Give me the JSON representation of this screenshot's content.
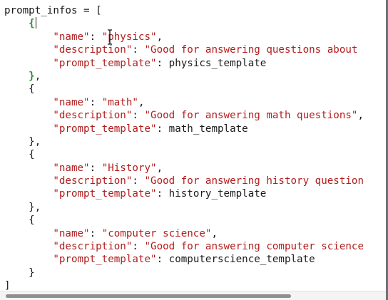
{
  "code": {
    "l1_var": "prompt_infos",
    "l1_rest": " = [",
    "indent1": "    ",
    "indent2": "        ",
    "open_brace": "{",
    "close_brace": "}",
    "close_brace_comma": "},",
    "close_bracket": "]",
    "key_name": "\"name\"",
    "key_description": "\"description\"",
    "key_prompt_template": "\"prompt_template\"",
    "colon": ": ",
    "comma": ",",
    "blocks": [
      {
        "name_value": "\"physics\"",
        "description_value": "\"Good for answering questions about",
        "template": "physics_template"
      },
      {
        "name_value": "\"math\"",
        "description_value": "\"Good for answering math questions\"",
        "template": "math_template"
      },
      {
        "name_value": "\"History\"",
        "description_value": "\"Good for answering history question",
        "template": "history_template"
      },
      {
        "name_value": "\"computer science\"",
        "description_value": "\"Good for answering computer science",
        "template": "computerscience_template"
      }
    ]
  },
  "colors": {
    "string": "#b21d1d",
    "plain": "#1a1a1a",
    "matched_brace": "#2f8f2f"
  }
}
